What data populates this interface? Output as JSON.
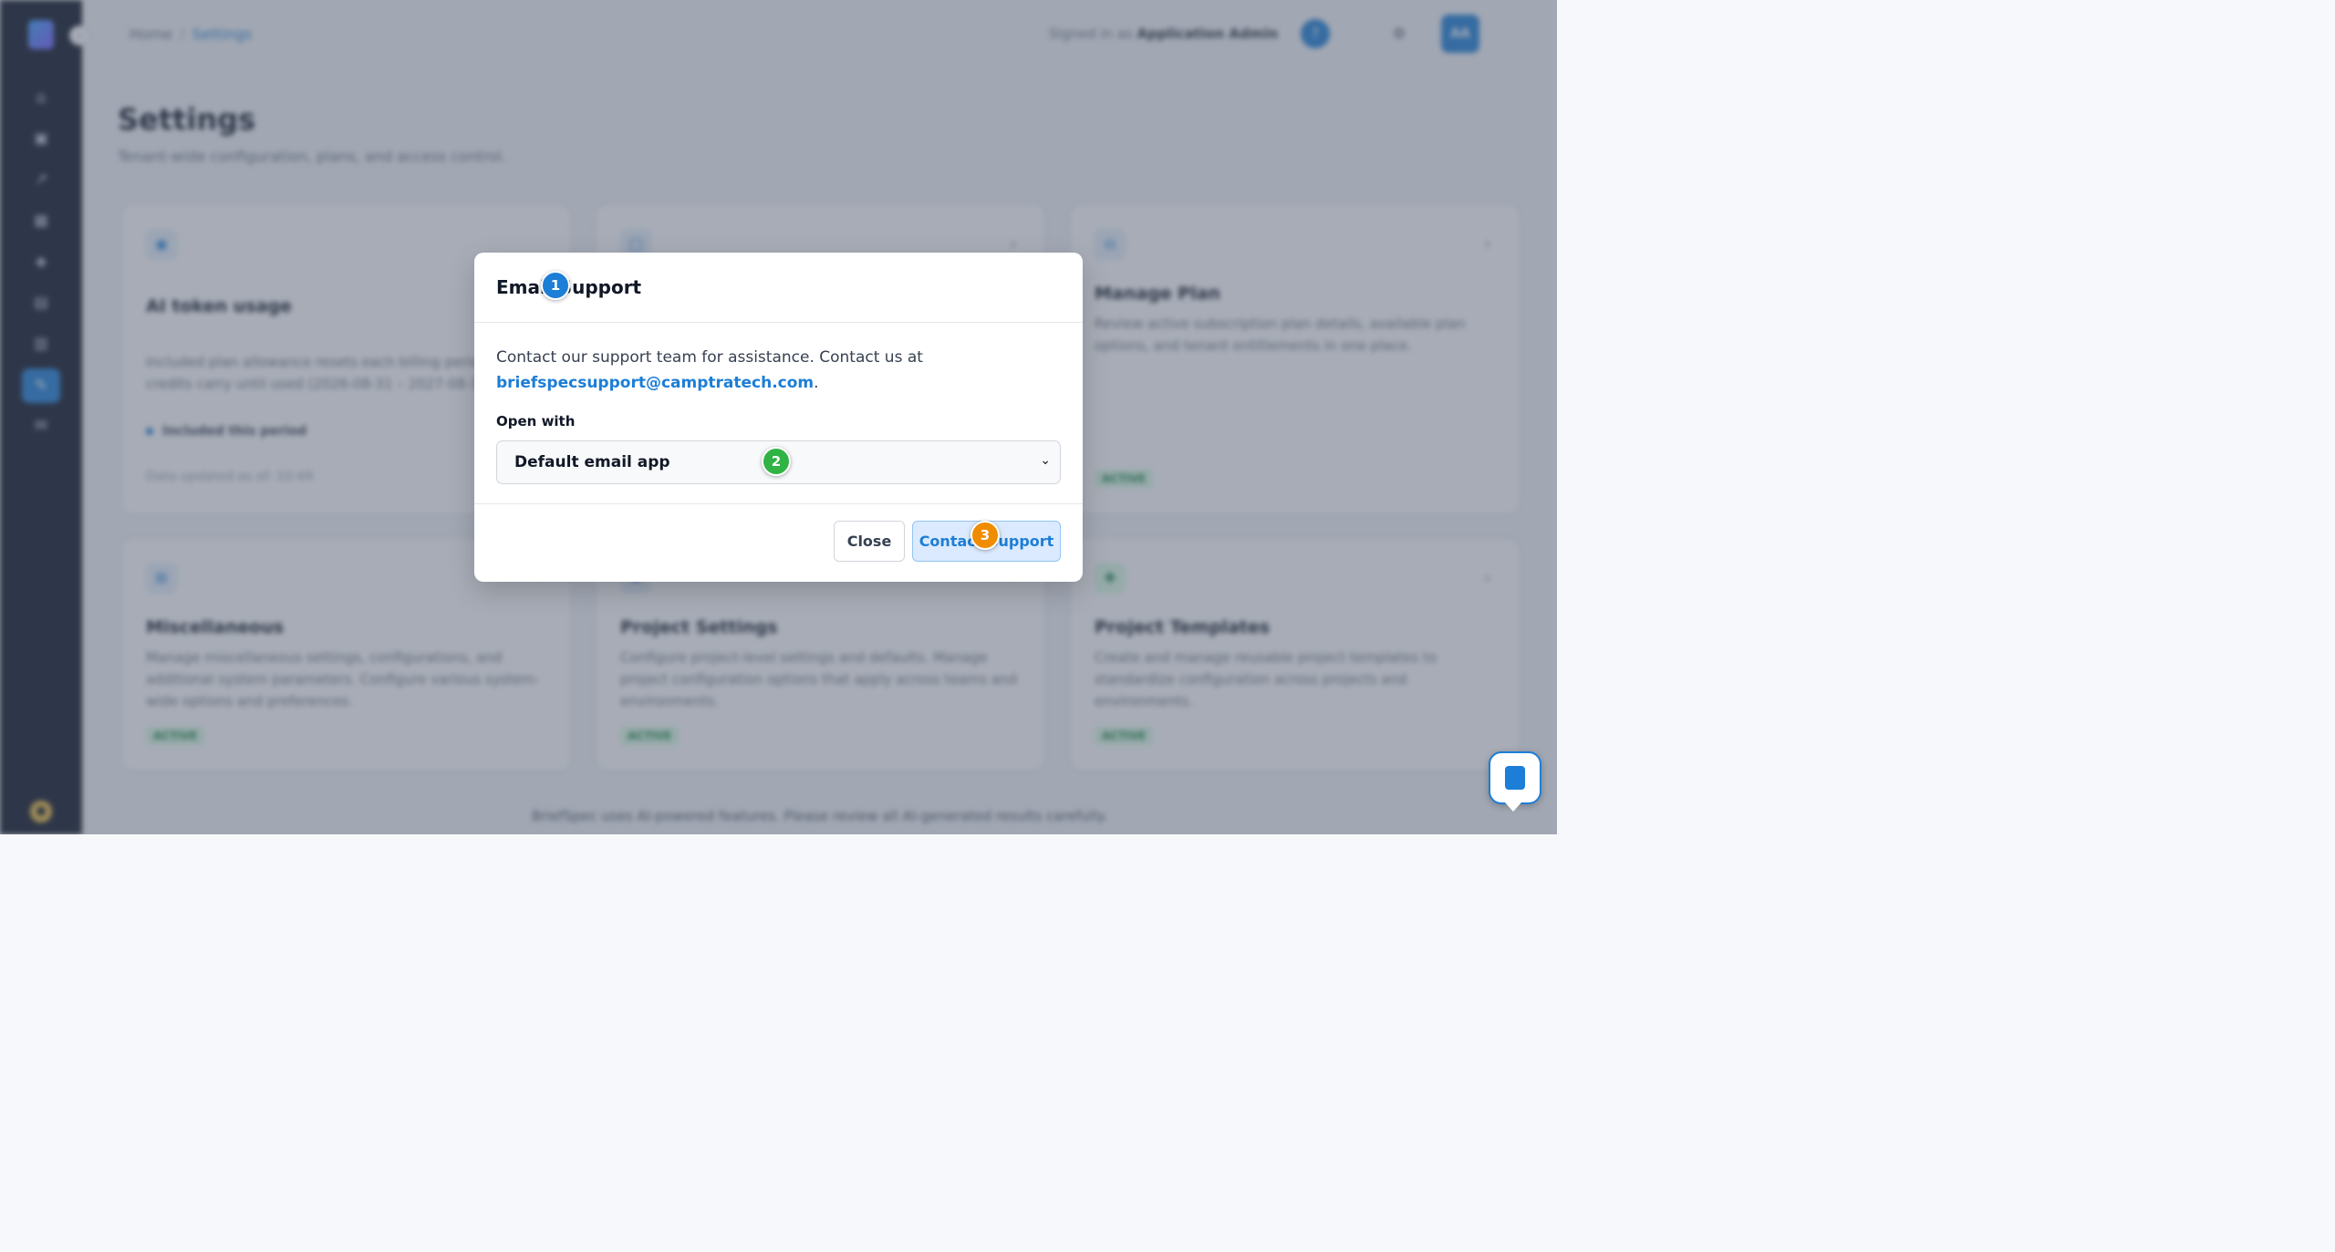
{
  "topbar": {
    "breadcrumb": [
      "Home",
      "Settings"
    ],
    "signed_in_prefix": "Signed in as",
    "signed_in_user": "Application Admin",
    "avatar_initials": "AA"
  },
  "page": {
    "title": "Settings",
    "subtitle": "Tenant-wide configuration, plans, and access control."
  },
  "cards": [
    {
      "title": "AI token usage",
      "description": "Included plan allowance resets each billing period. Service credits carry until used (2026-08-31 – 2027-08-31).",
      "included": "Included this period",
      "updated": "Data updated as of: 10:49"
    },
    {
      "title": "",
      "description": ""
    },
    {
      "title": "Manage Plan",
      "description": "Review active subscription plan details, available plan options, and tenant entitlements in one place.",
      "badge": "ACTIVE"
    },
    {
      "title": "Miscellaneous",
      "description": "Manage miscellaneous settings, configurations, and additional system parameters. Configure various system-wide options and preferences.",
      "badge": "ACTIVE"
    },
    {
      "title": "Project Settings",
      "description": "Configure project-level settings and defaults. Manage project configuration options that apply across teams and environments.",
      "badge": "ACTIVE"
    },
    {
      "title": "Project Templates",
      "description": "Create and manage reusable project templates to standardize configuration across projects and environments.",
      "badge": "ACTIVE"
    }
  ],
  "footer_note": "BriefSpec uses AI-powered features. Please review all AI-generated results carefully.",
  "modal": {
    "title": "Email Support",
    "body_text": "Contact our support team for assistance. Contact us at",
    "support_email": "briefspecsupport@camptratech.com",
    "trailing_period": ".",
    "open_with_label": "Open with",
    "open_with_value": "Default email app",
    "close_label": "Close",
    "contact_label": "Contact Support"
  },
  "markers": [
    "1",
    "2",
    "3"
  ],
  "colors": {
    "accent": "#1c7ed6",
    "sidebar": "#0d1424",
    "marker_1": "#1c7ed6",
    "marker_2": "#2fb344",
    "marker_3": "#f08c00"
  },
  "icons": {
    "sidebar": [
      "home-icon",
      "document-icon",
      "chart-icon",
      "calendar-icon",
      "inbox-icon",
      "file-icon",
      "archive-icon",
      "settings-icon",
      "megaphone-icon"
    ],
    "topbar": [
      "help-icon",
      "gear-icon"
    ],
    "modal": [
      "chevron-down-icon"
    ]
  }
}
